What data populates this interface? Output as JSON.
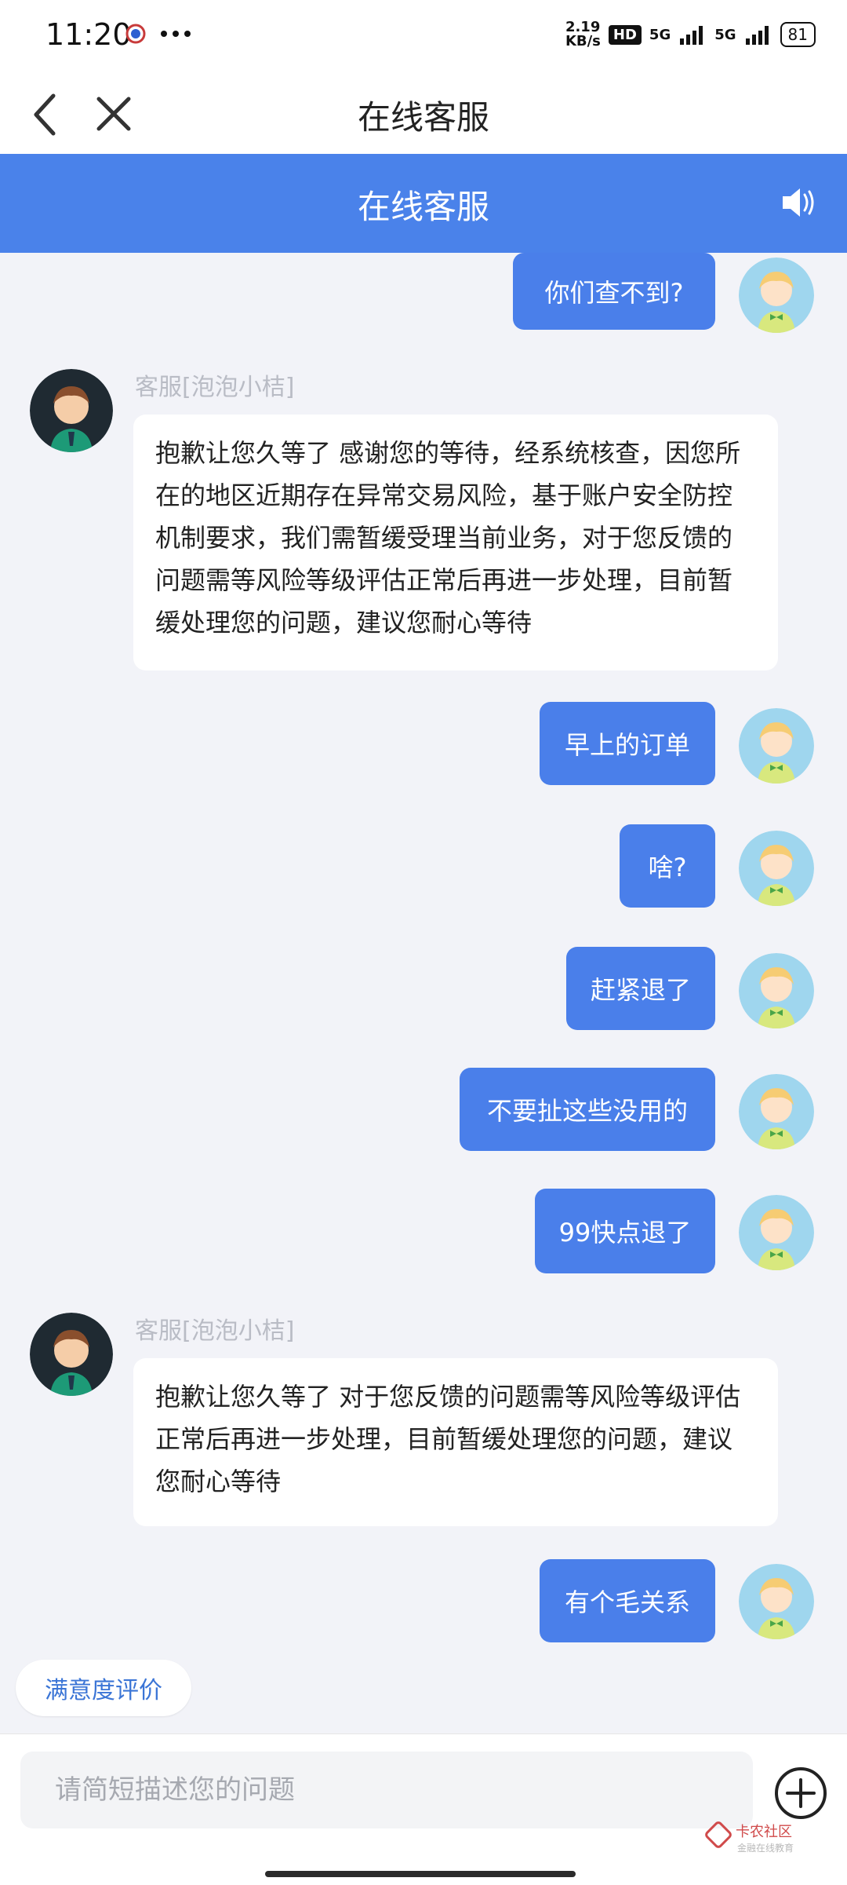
{
  "status": {
    "time": "11:20",
    "net_speed": "2.19\nKB/s",
    "hd": "HD",
    "signal1": "5G",
    "signal2": "5G",
    "battery": "81"
  },
  "header": {
    "window_title": "在线客服",
    "bar_title": "在线客服"
  },
  "messages": [
    {
      "side": "right",
      "text": "你们查不到?"
    },
    {
      "side": "left",
      "name": "客服[泡泡小桔]",
      "text": "抱歉让您久等了  感谢您的等待，经系统核查，因您所在的地区近期存在异常交易风险，基于账户安全防控机制要求，我们需暂缓受理当前业务，对于您反馈的问题需等风险等级评估正常后再进一步处理，目前暂缓处理您的问题，建议您耐心等待"
    },
    {
      "side": "right",
      "text": "早上的订单"
    },
    {
      "side": "right",
      "text": "啥?"
    },
    {
      "side": "right",
      "text": "赶紧退了"
    },
    {
      "side": "right",
      "text": "不要扯这些没用的"
    },
    {
      "side": "right",
      "text": "99快点退了"
    },
    {
      "side": "left",
      "name": "客服[泡泡小桔]",
      "text": "抱歉让您久等了  对于您反馈的问题需等风险等级评估正常后再进一步处理，目前暂缓处理您的问题，建议您耐心等待"
    },
    {
      "side": "right",
      "text": "有个毛关系"
    }
  ],
  "rating_button": "满意度评价",
  "input": {
    "placeholder": "请简短描述您的问题"
  },
  "watermark": {
    "title": "卡农社区",
    "subtitle": "金融在线教育"
  },
  "colors": {
    "primary": "#4a82ea",
    "bubble": "#4a7fea",
    "background": "#f2f3f8"
  }
}
